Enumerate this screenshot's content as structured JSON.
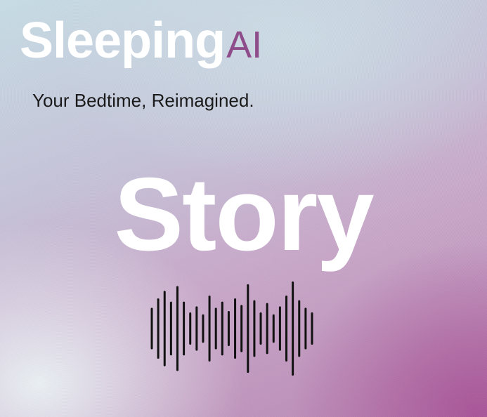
{
  "brand": {
    "name": "Sleeping",
    "suffix": "AI",
    "suffix_color": "#8e4c8a"
  },
  "tagline": "Your Bedtime, Reimagined.",
  "title": "Story",
  "waveform": {
    "icon": "audio-waveform-icon",
    "color": "#111111",
    "levels": [
      0.42,
      0.62,
      0.78,
      0.55,
      0.88,
      0.55,
      0.32,
      0.45,
      0.28,
      0.68,
      0.42,
      0.55,
      0.35,
      0.62,
      0.48,
      0.92,
      0.58,
      0.32,
      0.52,
      0.28,
      0.45,
      0.68,
      0.98,
      0.58,
      0.42,
      0.32
    ]
  }
}
